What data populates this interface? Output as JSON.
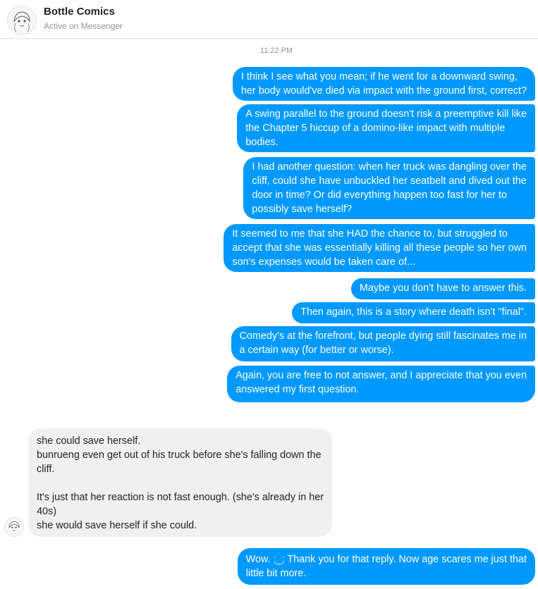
{
  "header": {
    "name": "Bottle Comics",
    "status": "Active on Messenger"
  },
  "timestamp": "11:22 PM",
  "messages": [
    {
      "from": "me",
      "text": "I think I see what you mean; if he went for a downward swing,\nher body would've died via impact with the ground first, correct?"
    },
    {
      "from": "me",
      "text": "A swing parallel to the ground doesn't risk a preemptive kill like\nthe Chapter 5 hiccup of a domino-like impact with multiple\nbodies."
    },
    {
      "from": "me",
      "text": "I had another question: when her truck was dangling over the\ncliff, could she have unbuckled her seatbelt and dived out the\ndoor in time? Or did everything happen too fast for her to\npossibly save herself?"
    },
    {
      "from": "me",
      "text": "It seemed to me that she HAD the chance to, but struggled to\naccept that she was essentially killing all these people so her own\nson's expenses would be taken care of..."
    },
    {
      "from": "me",
      "text": "Maybe you don't have to answer this."
    },
    {
      "from": "me",
      "text": "Then again, this is a story where death isn't \"final\"."
    },
    {
      "from": "me",
      "text": "Comedy's at the forefront, but people dying still fascinates me in\na certain way (for better or worse)."
    },
    {
      "from": "me",
      "text": "Again, you are free to not answer, and I appreciate that you even\nanswered my first question."
    },
    {
      "from": "them",
      "text": "she could save herself.\nbunrueng even get out of his truck before she's falling down the\ncliff.\n\nIt's just that her reaction is not fast enough. (she's already in her\n40s)\nshe would save herself if she could."
    },
    {
      "from": "me",
      "text": "Wow. ;_; Thank you for that reply. Now age scares me just that\nlittle bit more."
    }
  ],
  "colors": {
    "outgoing_bubble": "#0099ff",
    "incoming_bubble": "#f1f0f0",
    "header_status": "#90949c"
  },
  "icons": {
    "contact_avatar": "manga-avatar-icon"
  }
}
